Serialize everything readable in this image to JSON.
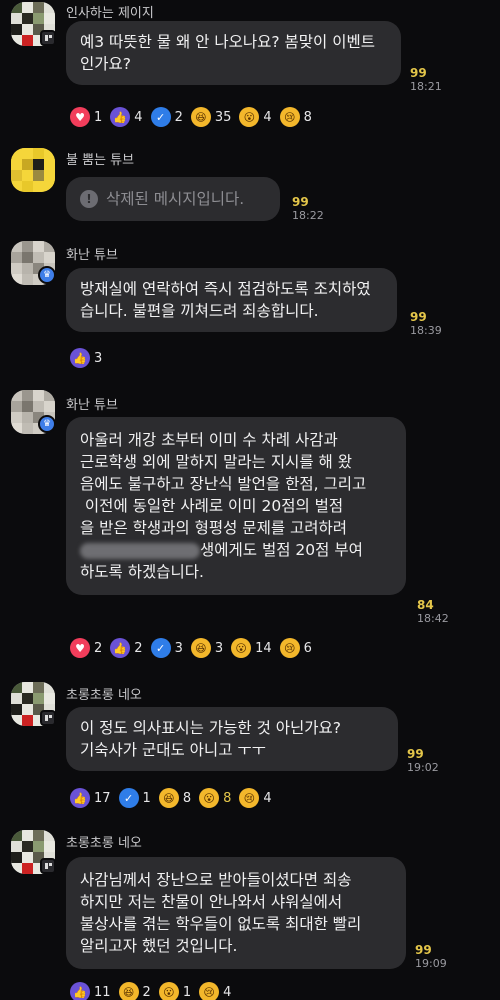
{
  "messages": [
    {
      "sender": "인사하는 제이지",
      "text": "예3 따뜻한 물 왜 안 나오나요? 봄맞이 이벤트인가요?",
      "count": "99",
      "time": "18:21",
      "reactions": [
        {
          "icon": "heart-icon",
          "count": "1"
        },
        {
          "icon": "thumbs-up-icon",
          "count": "4"
        },
        {
          "icon": "check-icon",
          "count": "2"
        },
        {
          "icon": "laugh-icon",
          "count": "35"
        },
        {
          "icon": "wow-icon",
          "count": "4"
        },
        {
          "icon": "sad-icon",
          "count": "8"
        }
      ]
    },
    {
      "sender": "불 뿜는 튜브",
      "text": "삭제된 메시지입니다.",
      "count": "99",
      "time": "18:22"
    },
    {
      "sender": "화난 튜브",
      "text": "방재실에 연락하여 즉시 점검하도록 조치하였습니다. 불편을 끼쳐드려 죄송합니다.",
      "count": "99",
      "time": "18:39",
      "reactions": [
        {
          "icon": "thumbs-up-icon",
          "count": "3"
        }
      ]
    },
    {
      "sender": "화난 튜브",
      "text_lines": [
        "아울러 개강 초부터 이미 수 차례 사감과",
        "근로학생 외에 말하지 말라는 지시를 해 왔",
        "음에도 불구하고 장난식 발언을 한점, 그리고",
        " 이전에 동일한 사례로 이미 20점의 벌점",
        "을 받은 학생과의 형평성 문제를 고려하려",
        "생에게도 벌점 20점 부여",
        "하도록 하겠습니다."
      ],
      "count": "84",
      "time": "18:42",
      "reactions": [
        {
          "icon": "heart-icon",
          "count": "2"
        },
        {
          "icon": "thumbs-up-icon",
          "count": "2"
        },
        {
          "icon": "check-icon",
          "count": "3"
        },
        {
          "icon": "laugh-icon",
          "count": "3"
        },
        {
          "icon": "wow-icon",
          "count": "14"
        },
        {
          "icon": "sad-icon",
          "count": "6"
        }
      ]
    },
    {
      "sender": "초롱초롱 네오",
      "text_lines": [
        "이 정도 의사표시는 가능한 것 아닌가요?",
        "기숙사가 군대도 아니고 ㅜㅜ"
      ],
      "count": "99",
      "time": "19:02",
      "reactions": [
        {
          "icon": "thumbs-up-icon",
          "count": "17"
        },
        {
          "icon": "check-icon",
          "count": "1"
        },
        {
          "icon": "laugh-icon",
          "count": "8"
        },
        {
          "icon": "wow-icon",
          "count": "8"
        },
        {
          "icon": "sad-icon",
          "count": "4"
        }
      ]
    },
    {
      "sender": "초롱초롱 네오",
      "text_lines": [
        "사감님께서 장난으로 받아들이셨다면 죄송",
        "하지만 저는 찬물이 안나와서 샤워실에서",
        "불상사를 겪는 학우들이 없도록 최대한 빨리",
        "알리고자 했던 것입니다."
      ],
      "count": "99",
      "time": "19:09",
      "reactions": [
        {
          "icon": "thumbs-up-icon",
          "count": "11"
        },
        {
          "icon": "laugh-icon",
          "count": "2"
        },
        {
          "icon": "wow-icon",
          "count": "1"
        },
        {
          "icon": "sad-icon",
          "count": "4"
        }
      ]
    }
  ]
}
